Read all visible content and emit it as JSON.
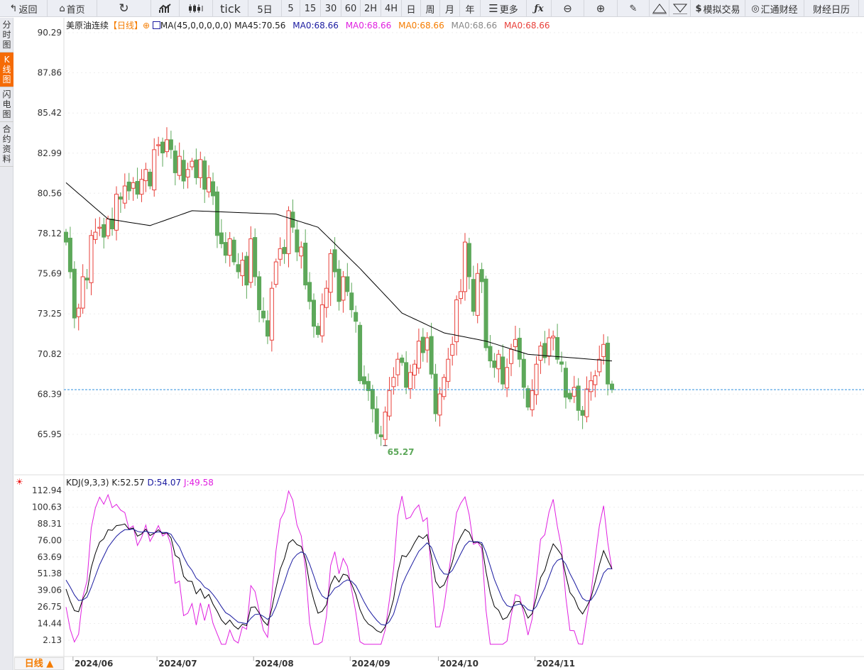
{
  "toolbar": {
    "back": "返回",
    "home": "首页",
    "tick": "tick",
    "5d": "5日",
    "m5": "5",
    "m15": "15",
    "m30": "30",
    "m60": "60",
    "h2": "2H",
    "h4": "4H",
    "day": "日",
    "week": "周",
    "month": "月",
    "year": "年",
    "more": "更多",
    "sim_trade": "模拟交易",
    "huitong": "汇通财经",
    "calendar": "财经日历"
  },
  "sidebar": [
    {
      "label": "分时图"
    },
    {
      "label": "K线图",
      "active": true
    },
    {
      "label": "闪电图"
    },
    {
      "label": "合约资料"
    }
  ],
  "legend": {
    "symbol": "美原油连续",
    "period": "【日线】",
    "ma_params": "MA(45,0,0,0,0,0)",
    "ma45": "MA45:70.56",
    "ma0_1": "MA0:68.66",
    "ma0_2": "MA0:68.66",
    "ma0_3": "MA0:68.66",
    "ma0_4": "MA0:68.66",
    "ma0_5": "MA0:68.66"
  },
  "kdj_legend": {
    "name": "KDJ(9,3,3)",
    "k": "K:52.57",
    "d": "D:54.07",
    "j": "J:49.58"
  },
  "bottom_tab": "日线 ▲",
  "colors": {
    "up": "#e8403a",
    "down": "#5da85a",
    "ma45": "#000000",
    "k": "#000000",
    "d": "#1a1aa0",
    "j": "#e020e0",
    "last": "#2f8fdf"
  },
  "chart_data": {
    "type": "candlestick",
    "title": "美原油连续 日线",
    "price_ticks": [
      "90.29",
      "87.86",
      "85.42",
      "82.99",
      "80.56",
      "78.12",
      "75.69",
      "73.25",
      "70.82",
      "68.39",
      "65.95"
    ],
    "ylim": [
      65.95,
      90.29
    ],
    "last_price": 68.66,
    "min_label": "65.27",
    "min_value": 65.27,
    "closes": [
      77.6,
      75.8,
      73.0,
      73.6,
      75.5,
      75.3,
      78.0,
      78.2,
      78.5,
      77.9,
      79.0,
      78.4,
      80.5,
      80.2,
      81.0,
      80.7,
      81.2,
      80.5,
      81.4,
      82.0,
      81.0,
      83.2,
      83.5,
      83.0,
      83.8,
      83.2,
      81.8,
      82.8,
      81.3,
      82.0,
      82.5,
      81.5,
      82.6,
      80.8,
      81.5,
      80.4,
      78.0,
      77.5,
      76.8,
      77.8,
      76.4,
      75.8,
      76.5,
      75.0,
      77.8,
      75.5,
      73.5,
      73.0,
      71.9,
      74.8,
      76.4,
      77.2,
      76.9,
      79.5,
      78.5,
      77.0,
      77.3,
      75.0,
      74.0,
      72.5,
      72.0,
      73.8,
      74.8,
      76.9,
      75.8,
      74.0,
      75.5,
      74.6,
      73.5,
      72.8,
      69.2,
      69.0,
      68.6,
      67.5,
      66.0,
      65.8,
      67.3,
      68.6,
      69.4,
      70.5,
      70.3,
      68.8,
      69.7,
      70.2,
      71.6,
      70.9,
      71.8,
      69.6,
      67.2,
      68.4,
      69.4,
      70.5,
      71.4,
      74.1,
      74.6,
      77.6,
      75.5,
      73.4,
      75.7,
      75.2,
      71.2,
      70.4,
      70.0,
      70.8,
      69.0,
      70.0,
      71.1,
      71.7,
      70.5,
      68.8,
      67.6,
      68.6,
      70.2,
      71.3,
      70.6,
      71.8,
      71.9,
      70.5,
      70.2,
      68.2,
      68.1,
      68.8,
      67.4,
      67.1,
      68.7,
      69.2,
      69.5,
      70.5,
      71.4,
      69.0,
      68.66
    ],
    "ma45_samples_every_10": [
      81.2,
      79.0,
      78.6,
      79.5,
      79.4,
      79.3,
      78.5,
      76.0,
      73.3,
      72.1,
      71.6,
      70.8,
      70.6,
      70.4
    ],
    "kdj_ticks": [
      "112.94",
      "100.63",
      "88.31",
      "76.00",
      "63.69",
      "51.38",
      "39.06",
      "26.75",
      "14.44",
      "2.13"
    ],
    "kdj_ylim": [
      2.13,
      112.94
    ],
    "x_labels": [
      {
        "label": "2024/06",
        "index": 2
      },
      {
        "label": "2024/07",
        "index": 22
      },
      {
        "label": "2024/08",
        "index": 45
      },
      {
        "label": "2024/09",
        "index": 68
      },
      {
        "label": "2024/10",
        "index": 89
      },
      {
        "label": "2024/11",
        "index": 112
      }
    ]
  }
}
